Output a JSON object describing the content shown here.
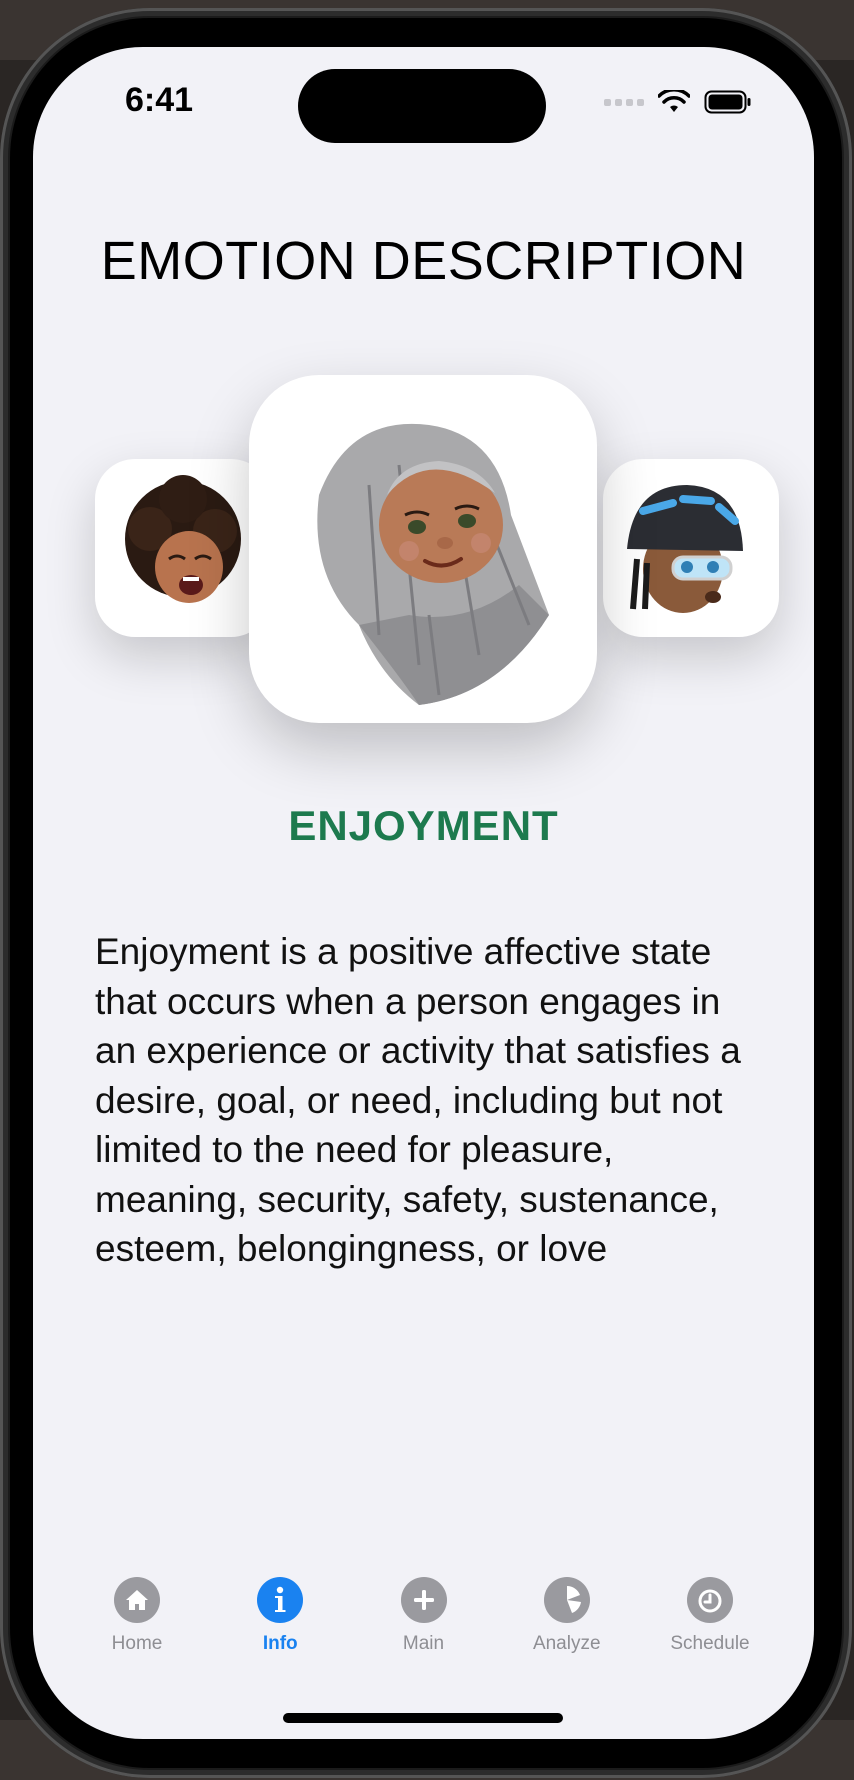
{
  "status_bar": {
    "time": "6:41"
  },
  "page": {
    "title": "EMOTION DESCRIPTION",
    "emotion_name": "ENJOYMENT",
    "description": "Enjoyment is a positive affective state that occurs when a person engages in an experience or activity that satisfies a desire, goal, or need, including but not limited to the need for pleasure, meaning, security, safety, sustenance, esteem, belongingness, or love"
  },
  "carousel": {
    "cards": [
      {
        "name": "laughing-avatar"
      },
      {
        "name": "gray-hair-avatar"
      },
      {
        "name": "helmet-avatar"
      }
    ]
  },
  "tabbar": {
    "items": [
      {
        "label": "Home",
        "icon": "home-icon",
        "active": false
      },
      {
        "label": "Info",
        "icon": "info-icon",
        "active": true
      },
      {
        "label": "Main",
        "icon": "plus-icon",
        "active": false
      },
      {
        "label": "Analyze",
        "icon": "pie-chart-icon",
        "active": false
      },
      {
        "label": "Schedule",
        "icon": "alarm-icon",
        "active": false
      }
    ]
  },
  "colors": {
    "accent": "#1a82f0",
    "emotion": "#1d7a4e",
    "background": "#f2f2f7"
  }
}
